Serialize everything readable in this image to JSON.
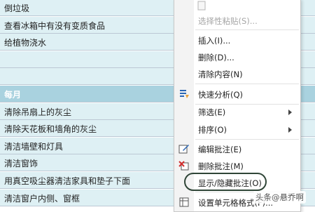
{
  "sheet": {
    "rows": [
      {
        "text": "倒垃圾",
        "header": false
      },
      {
        "text": "查看冰箱中有没有变质食品",
        "header": false
      },
      {
        "text": "给植物浇水",
        "header": false
      },
      {
        "text": "",
        "header": false
      },
      {
        "text": "",
        "header": false
      },
      {
        "text": "每月",
        "header": true
      },
      {
        "text": "清除吊扇上的灰尘",
        "header": false
      },
      {
        "text": "清除天花板和墙角的灰尘",
        "header": false
      },
      {
        "text": "清洁墙壁和灯具",
        "header": false
      },
      {
        "text": "清洁窗饰",
        "header": false
      },
      {
        "text": "用真空吸尘器清洁家具和垫子下面",
        "header": false
      },
      {
        "text": "清洁窗户内侧、窗框",
        "header": false
      }
    ]
  },
  "menu": {
    "items": {
      "paste_special": "选择性粘贴(S)...",
      "insert": "插入(I)...",
      "delete": "删除(D)...",
      "clear": "清除内容(N)",
      "quick_analysis": "快速分析(Q)",
      "filter": "筛选(E)",
      "sort": "排序(O)",
      "edit_comment": "编辑批注(E)",
      "delete_comment": "删除批注(M)",
      "show_hide_comments": "显示/隐藏批注(O)",
      "format_cells": "设置单元格格式(F)..."
    }
  },
  "watermark": "头条@悬乔啊",
  "colors": {
    "row_bg": "#def0f4",
    "header_bg": "#a9d2df",
    "ring": "#2f4537"
  }
}
